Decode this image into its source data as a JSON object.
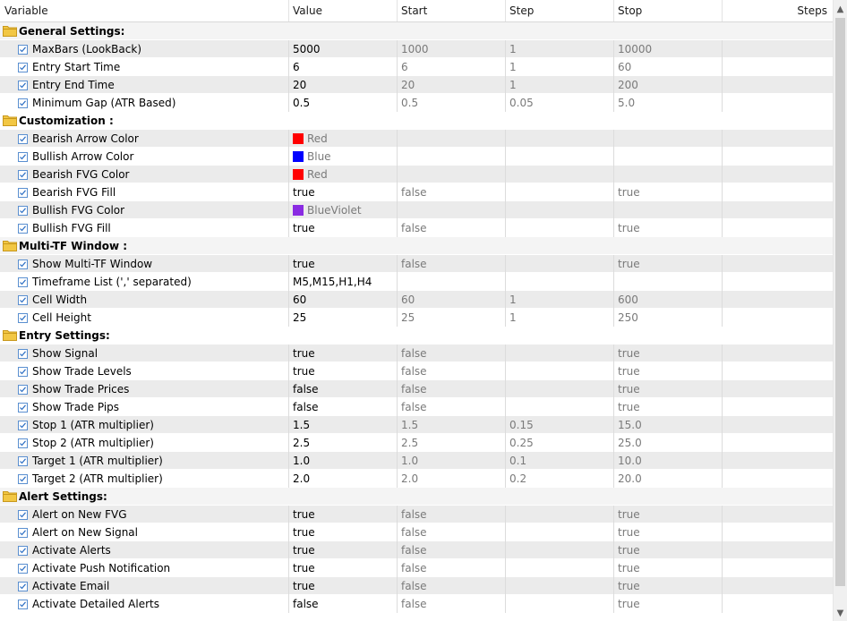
{
  "columns": {
    "variable": "Variable",
    "value": "Value",
    "start": "Start",
    "step": "Step",
    "stop": "Stop",
    "steps": "Steps"
  },
  "groups": [
    {
      "title": "General Settings:",
      "rows": [
        {
          "name": "MaxBars (LookBack)",
          "value": "5000",
          "start": "1000",
          "step": "1",
          "stop": "10000"
        },
        {
          "name": "Entry Start Time",
          "value": "6",
          "start": "6",
          "step": "1",
          "stop": "60"
        },
        {
          "name": "Entry End Time",
          "value": "20",
          "start": "20",
          "step": "1",
          "stop": "200"
        },
        {
          "name": "Minimum Gap (ATR Based)",
          "value": "0.5",
          "start": "0.5",
          "step": "0.05",
          "stop": "5.0"
        }
      ]
    },
    {
      "title": "Customization :",
      "rows": [
        {
          "name": "Bearish Arrow Color",
          "value": "Red",
          "color": "#ff0000",
          "start": "",
          "step": "",
          "stop": ""
        },
        {
          "name": "Bullish Arrow Color",
          "value": "Blue",
          "color": "#0000ff",
          "start": "",
          "step": "",
          "stop": ""
        },
        {
          "name": "Bearish FVG Color",
          "value": "Red",
          "color": "#ff0000",
          "start": "",
          "step": "",
          "stop": ""
        },
        {
          "name": "Bearish FVG Fill",
          "value": "true",
          "start": "false",
          "step": "",
          "stop": "true"
        },
        {
          "name": "Bullish FVG Color",
          "value": "BlueViolet",
          "color": "#8a2be2",
          "start": "",
          "step": "",
          "stop": ""
        },
        {
          "name": "Bullish FVG Fill",
          "value": "true",
          "start": "false",
          "step": "",
          "stop": "true"
        }
      ]
    },
    {
      "title": "Multi-TF Window :",
      "rows": [
        {
          "name": "Show Multi-TF Window",
          "value": "true",
          "start": "false",
          "step": "",
          "stop": "true"
        },
        {
          "name": "Timeframe List (',' separated)",
          "value": "M5,M15,H1,H4",
          "start": "",
          "step": "",
          "stop": ""
        },
        {
          "name": "Cell Width",
          "value": "60",
          "start": "60",
          "step": "1",
          "stop": "600"
        },
        {
          "name": "Cell Height",
          "value": "25",
          "start": "25",
          "step": "1",
          "stop": "250"
        }
      ]
    },
    {
      "title": "Entry Settings:",
      "rows": [
        {
          "name": "Show Signal",
          "value": "true",
          "start": "false",
          "step": "",
          "stop": "true"
        },
        {
          "name": "Show Trade Levels",
          "value": "true",
          "start": "false",
          "step": "",
          "stop": "true"
        },
        {
          "name": "Show Trade Prices",
          "value": "false",
          "start": "false",
          "step": "",
          "stop": "true"
        },
        {
          "name": "Show Trade Pips",
          "value": "false",
          "start": "false",
          "step": "",
          "stop": "true"
        },
        {
          "name": "Stop 1 (ATR multiplier)",
          "value": "1.5",
          "start": "1.5",
          "step": "0.15",
          "stop": "15.0"
        },
        {
          "name": "Stop 2 (ATR multiplier)",
          "value": "2.5",
          "start": "2.5",
          "step": "0.25",
          "stop": "25.0"
        },
        {
          "name": "Target 1 (ATR multiplier)",
          "value": "1.0",
          "start": "1.0",
          "step": "0.1",
          "stop": "10.0"
        },
        {
          "name": "Target 2 (ATR multiplier)",
          "value": "2.0",
          "start": "2.0",
          "step": "0.2",
          "stop": "20.0"
        }
      ]
    },
    {
      "title": "Alert Settings:",
      "rows": [
        {
          "name": "Alert on New FVG",
          "value": "true",
          "start": "false",
          "step": "",
          "stop": "true"
        },
        {
          "name": "Alert on New Signal",
          "value": "true",
          "start": "false",
          "step": "",
          "stop": "true"
        },
        {
          "name": "Activate Alerts",
          "value": "true",
          "start": "false",
          "step": "",
          "stop": "true"
        },
        {
          "name": "Activate Push Notification",
          "value": "true",
          "start": "false",
          "step": "",
          "stop": "true"
        },
        {
          "name": "Activate Email",
          "value": "true",
          "start": "false",
          "step": "",
          "stop": "true"
        },
        {
          "name": "Activate Detailed Alerts",
          "value": "false",
          "start": "false",
          "step": "",
          "stop": "true"
        }
      ]
    }
  ],
  "icons": {
    "folder": "folder-icon",
    "checkbox": "checkbox-checked-icon",
    "scroll_up": "scroll-up-arrow-icon",
    "scroll_down": "scroll-down-arrow-icon"
  },
  "colors": {
    "folder": "#f2c744",
    "checkbox_border": "#5a8fd0",
    "row_alt": "#ebebeb"
  }
}
